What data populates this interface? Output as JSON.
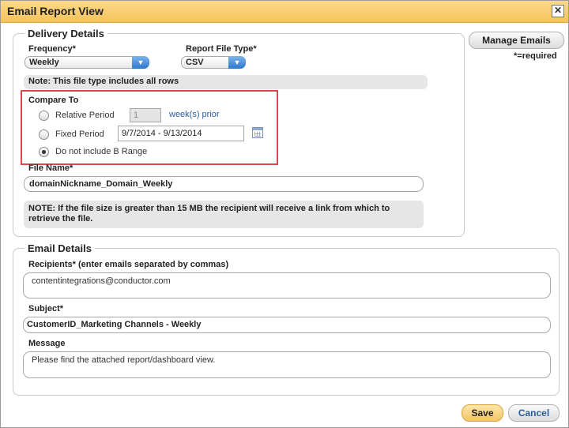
{
  "window": {
    "title": "Email Report View",
    "close_glyph": "✕"
  },
  "delivery": {
    "legend": "Delivery Details",
    "frequency_label": "Frequency*",
    "frequency_value": "Weekly",
    "file_type_label": "Report File Type*",
    "file_type_value": "CSV",
    "file_type_note": "Note: This file type includes all rows",
    "compare_to_label": "Compare To",
    "relative_period_label": "Relative Period",
    "relative_period_value": "1",
    "relative_period_suffix": "week(s) prior",
    "fixed_period_label": "Fixed Period",
    "fixed_period_value": "9/7/2014 - 9/13/2014",
    "no_b_range_label": "Do not include B Range",
    "file_name_label": "File Name*",
    "file_name_value": "domainNickname_Domain_Weekly",
    "size_note": "NOTE: If the file size is greater than 15 MB the recipient will receive a link from which to retrieve the file."
  },
  "side": {
    "manage_emails": "Manage Emails",
    "required_note": "*=required"
  },
  "email": {
    "legend": "Email Details",
    "recipients_label": "Recipients* (enter emails separated by commas)",
    "recipients_value": "contentintegrations@conductor.com",
    "subject_label": "Subject*",
    "subject_value": "CustomerID_Marketing Channels - Weekly",
    "message_label": "Message",
    "message_value": "Please find the attached report/dashboard view."
  },
  "footer": {
    "save_label": "Save",
    "cancel_label": "Cancel"
  },
  "colors": {
    "titlebar": "#f5c35a",
    "highlight_border": "#d84a4a",
    "save_button": "#f2c56a",
    "link_blue": "#2a5d9c"
  },
  "icons": [
    "close-icon",
    "dropdown-arrow-icon",
    "calendar-icon"
  ]
}
